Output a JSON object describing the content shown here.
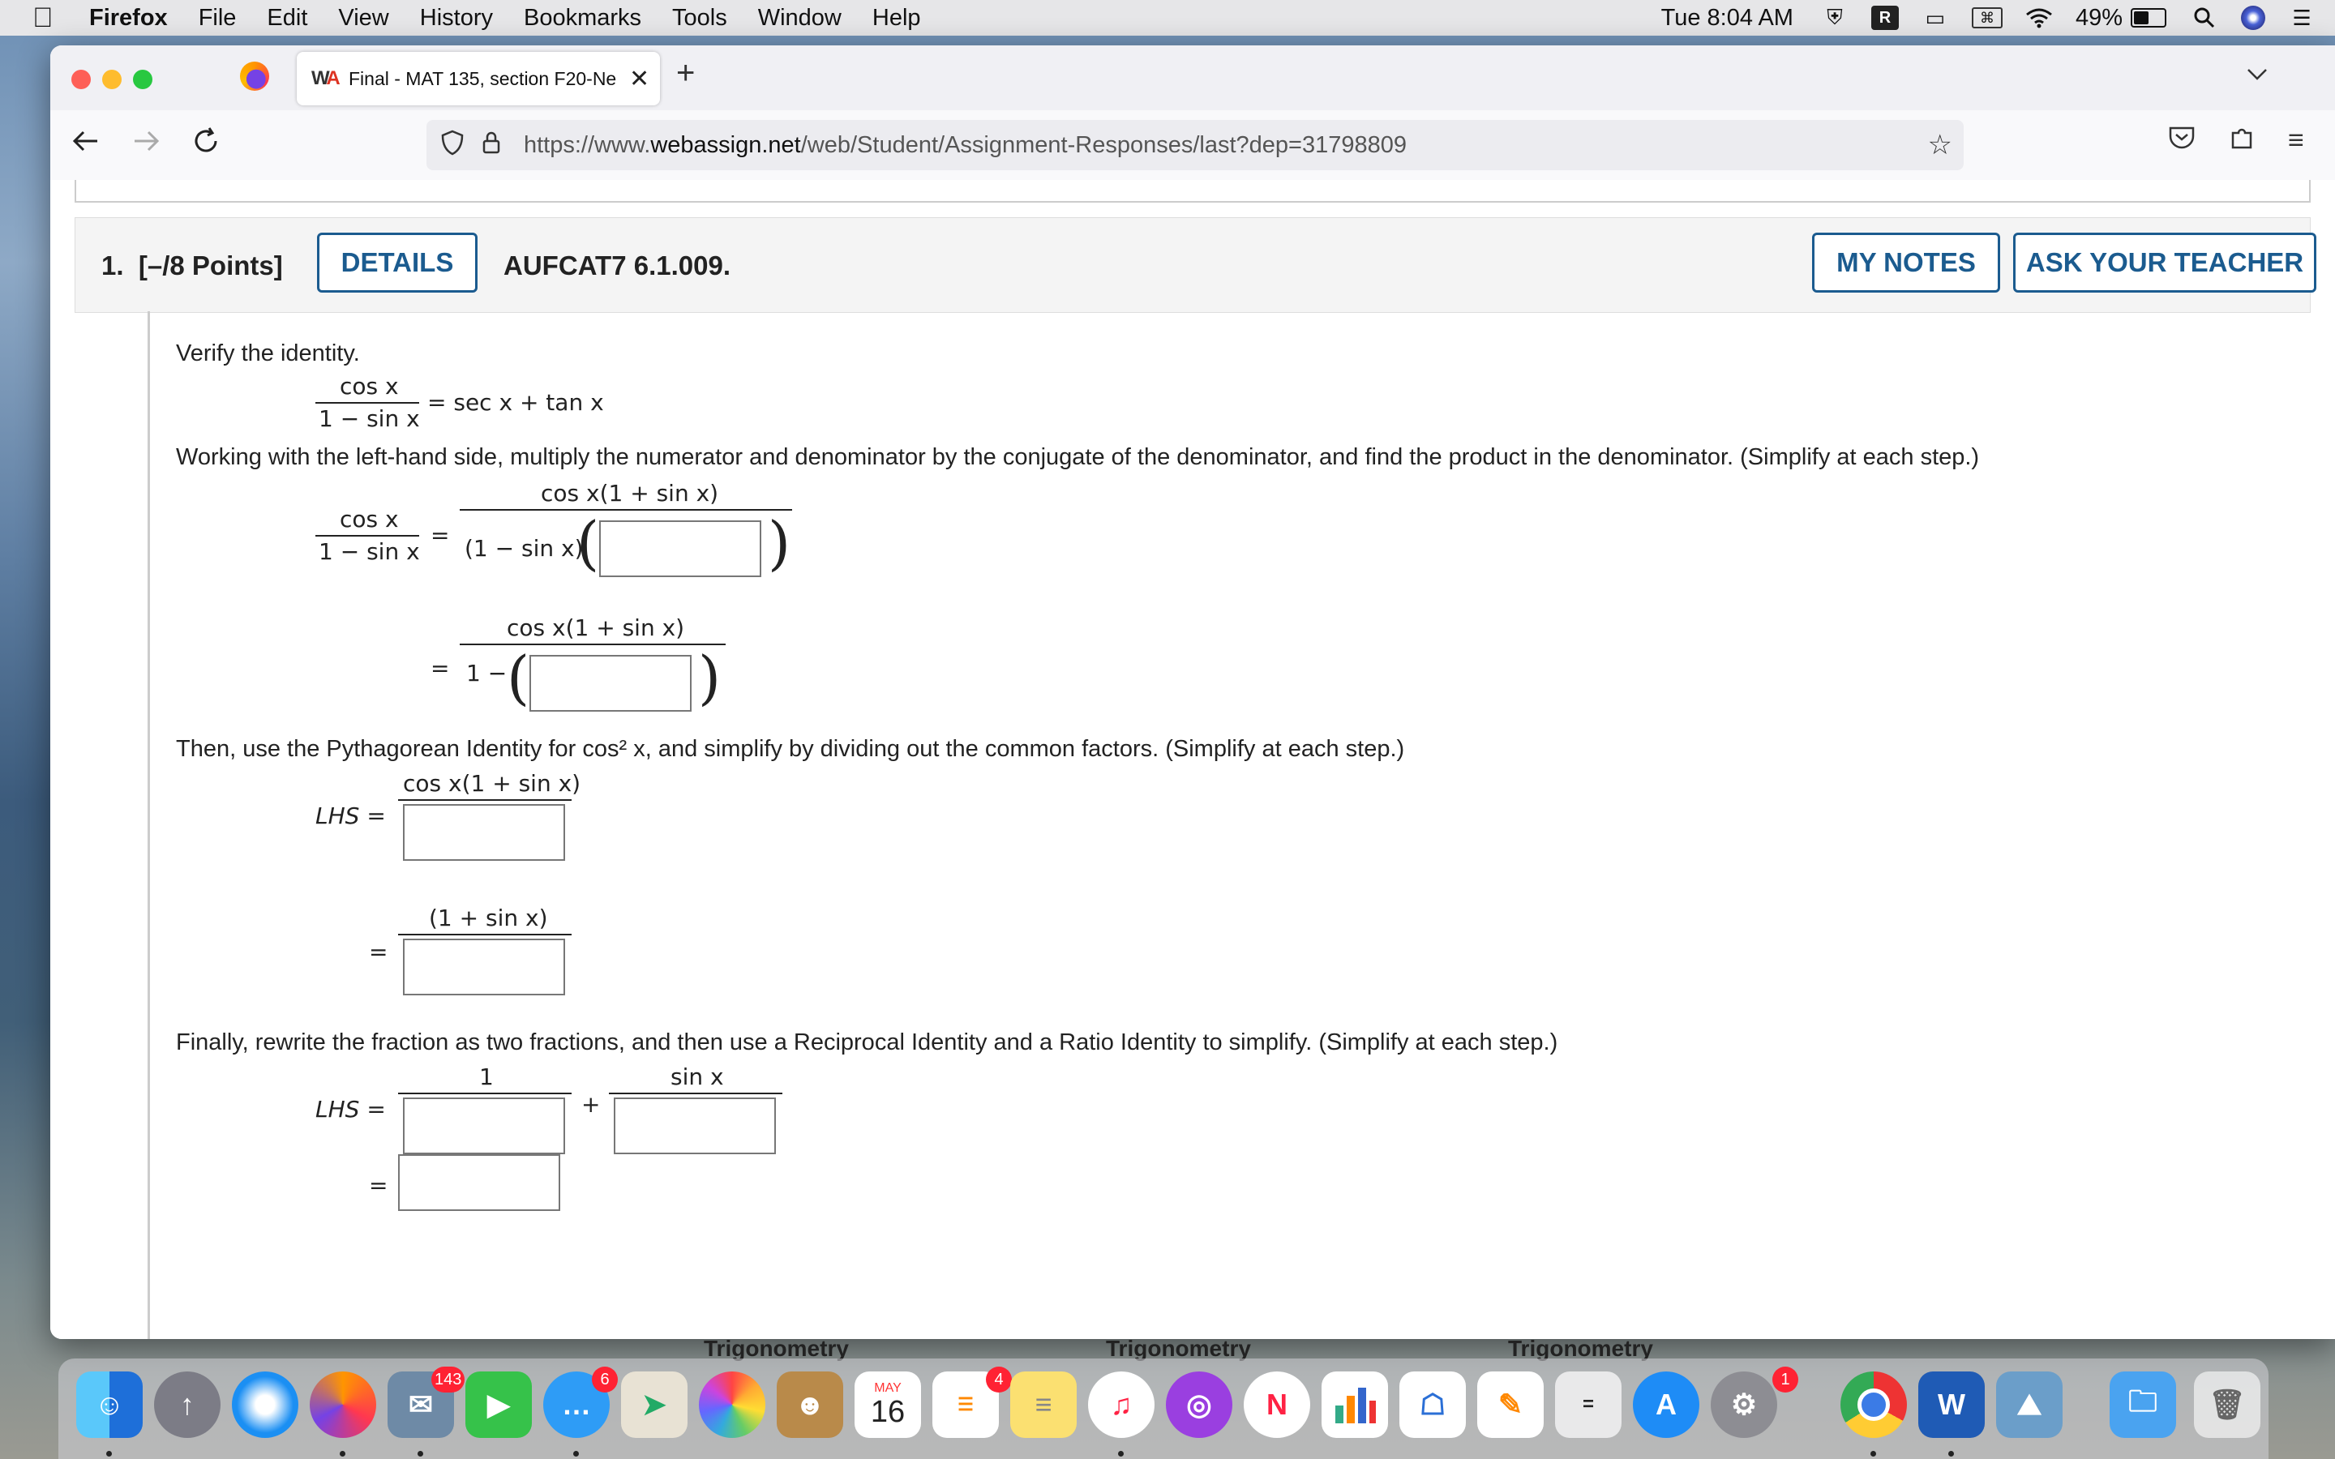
{
  "menubar": {
    "app": "Firefox",
    "items": [
      "File",
      "Edit",
      "View",
      "History",
      "Bookmarks",
      "Tools",
      "Window",
      "Help"
    ],
    "clock": "Tue 8:04 AM",
    "battery": "49%",
    "battery_level": 0.49
  },
  "browser": {
    "tab_title": "Final - MAT 135, section F20-Ne",
    "url_prefix": "https://www.",
    "url_domain": "webassign.net",
    "url_path": "/web/Student/Assignment-Responses/last?dep=31798809"
  },
  "question": {
    "number": "1.",
    "points": "[–/8 Points]",
    "details_label": "DETAILS",
    "code": "AUFCAT7 6.1.009.",
    "my_notes_label": "MY NOTES",
    "ask_teacher_label": "ASK YOUR TEACHER",
    "intro": "Verify the identity.",
    "identity_num": "cos x",
    "identity_den": "1 − sin x",
    "identity_rhs": "= sec x + tan x",
    "step1_text": "Working with the left-hand side, multiply the numerator and denominator by the conjugate of the denominator, and find the product in the denominator. (Simplify at each step.)",
    "step1_rhs_num": "cos x(1 + sin x)",
    "step1_rhs_den_prefix": "(1 − sin x)",
    "step1b_den_prefix": "1 −",
    "equals": "=",
    "step2_text": "Then, use the Pythagorean Identity for  cos² x,  and simplify by dividing out the common factors. (Simplify at each step.)",
    "lhs_label": "LHS =",
    "step2_num": "cos x(1 + sin x)",
    "step2b_num": "(1 + sin x)",
    "step3_text": "Finally, rewrite the fraction as two fractions, and then use a Reciprocal Identity and a Ratio Identity to simplify. (Simplify at each step.)",
    "step3_num1": "1",
    "step3_num2": "sin x",
    "plus": "+"
  },
  "dock": {
    "labels": [
      "Trigonometry",
      "Trigonometry",
      "Trigonometry"
    ],
    "badges": {
      "mail": "143",
      "messages": "6",
      "reminders": "4",
      "settings": "1"
    },
    "calendar_month": "MAY",
    "calendar_day": "16"
  }
}
